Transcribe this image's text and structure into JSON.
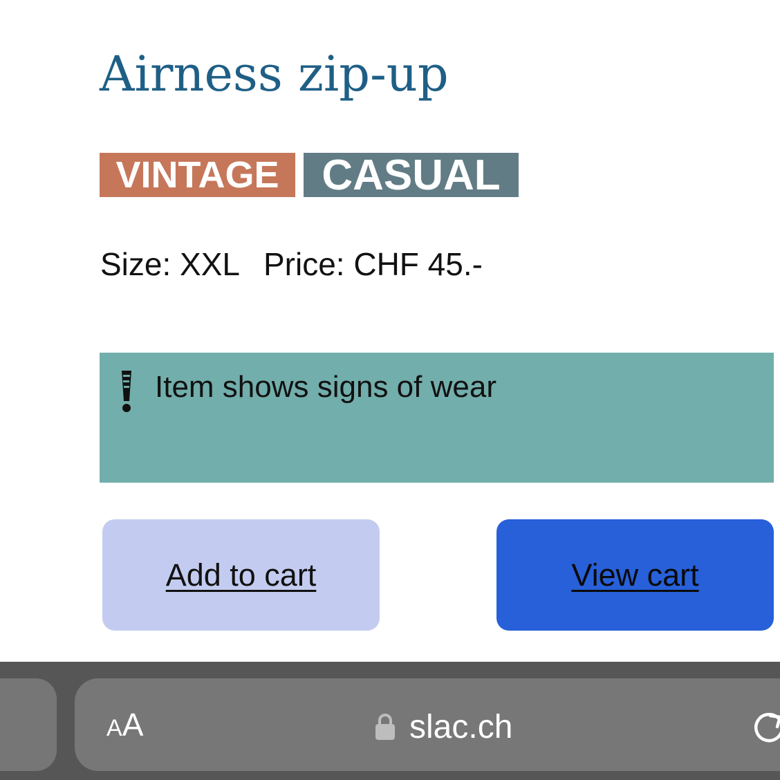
{
  "product": {
    "title": "Airness zip-up",
    "tags": [
      {
        "label": "VINTAGE",
        "color": "#c6775a"
      },
      {
        "label": "CASUAL",
        "color": "#627c86"
      }
    ],
    "size": "Size: XXL",
    "price": "Price: CHF 45.-"
  },
  "notice": {
    "icon": "exclamation-icon",
    "text": "Item shows signs of wear",
    "background": "#72aeab"
  },
  "actions": {
    "add_to_cart": "Add to cart",
    "view_cart": "View cart",
    "add_color": "#c3ccf0",
    "view_color": "#2760d9"
  },
  "browser": {
    "text_size_small": "A",
    "text_size_large": "A",
    "url": "slac.ch",
    "lock_icon": "lock-icon",
    "reload_icon": "reload-icon"
  },
  "colors": {
    "title": "#1f5f86"
  }
}
